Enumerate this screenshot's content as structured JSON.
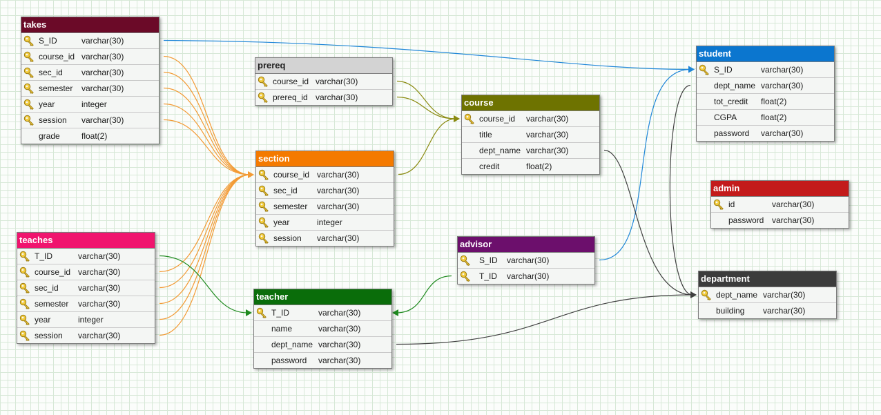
{
  "colors": {
    "takes": "#6b0a28",
    "prereq": "#d3d3d3",
    "course": "#6e7300",
    "section": "#f47a00",
    "student": "#0b76cf",
    "admin": "#c31b1b",
    "teaches": "#f0146e",
    "advisor": "#6c0f6c",
    "teacher": "#0a6d0a",
    "department": "#3c3c3c",
    "edge_orange": "#f39a34",
    "edge_olive": "#8a8a10",
    "edge_blue": "#1f86d8",
    "edge_green": "#1f8a1f",
    "edge_dark": "#404040"
  },
  "tables": {
    "takes": {
      "name": "takes",
      "columns": [
        {
          "name": "S_ID",
          "type": "varchar(30)",
          "key": true
        },
        {
          "name": "course_id",
          "type": "varchar(30)",
          "key": true
        },
        {
          "name": "sec_id",
          "type": "varchar(30)",
          "key": true
        },
        {
          "name": "semester",
          "type": "varchar(30)",
          "key": true
        },
        {
          "name": "year",
          "type": "integer",
          "key": true
        },
        {
          "name": "session",
          "type": "varchar(30)",
          "key": true
        },
        {
          "name": "grade",
          "type": "float(2)",
          "key": false
        }
      ]
    },
    "prereq": {
      "name": "prereq",
      "columns": [
        {
          "name": "course_id",
          "type": "varchar(30)",
          "key": true
        },
        {
          "name": "prereq_id",
          "type": "varchar(30)",
          "key": true
        }
      ]
    },
    "course": {
      "name": "course",
      "columns": [
        {
          "name": "course_id",
          "type": "varchar(30)",
          "key": true
        },
        {
          "name": "title",
          "type": "varchar(30)",
          "key": false
        },
        {
          "name": "dept_name",
          "type": "varchar(30)",
          "key": false
        },
        {
          "name": "credit",
          "type": "float(2)",
          "key": false
        }
      ]
    },
    "section": {
      "name": "section",
      "columns": [
        {
          "name": "course_id",
          "type": "varchar(30)",
          "key": true
        },
        {
          "name": "sec_id",
          "type": "varchar(30)",
          "key": true
        },
        {
          "name": "semester",
          "type": "varchar(30)",
          "key": true
        },
        {
          "name": "year",
          "type": "integer",
          "key": true
        },
        {
          "name": "session",
          "type": "varchar(30)",
          "key": true
        }
      ]
    },
    "student": {
      "name": "student",
      "columns": [
        {
          "name": "S_ID",
          "type": "varchar(30)",
          "key": true
        },
        {
          "name": "dept_name",
          "type": "varchar(30)",
          "key": false
        },
        {
          "name": "tot_credit",
          "type": "float(2)",
          "key": false
        },
        {
          "name": "CGPA",
          "type": "float(2)",
          "key": false
        },
        {
          "name": "password",
          "type": "varchar(30)",
          "key": false
        }
      ]
    },
    "admin": {
      "name": "admin",
      "columns": [
        {
          "name": "id",
          "type": "varchar(30)",
          "key": true
        },
        {
          "name": "password",
          "type": "varchar(30)",
          "key": false
        }
      ]
    },
    "teaches": {
      "name": "teaches",
      "columns": [
        {
          "name": "T_ID",
          "type": "varchar(30)",
          "key": true
        },
        {
          "name": "course_id",
          "type": "varchar(30)",
          "key": true
        },
        {
          "name": "sec_id",
          "type": "varchar(30)",
          "key": true
        },
        {
          "name": "semester",
          "type": "varchar(30)",
          "key": true
        },
        {
          "name": "year",
          "type": "integer",
          "key": true
        },
        {
          "name": "session",
          "type": "varchar(30)",
          "key": true
        }
      ]
    },
    "advisor": {
      "name": "advisor",
      "columns": [
        {
          "name": "S_ID",
          "type": "varchar(30)",
          "key": true
        },
        {
          "name": "T_ID",
          "type": "varchar(30)",
          "key": true
        }
      ]
    },
    "teacher": {
      "name": "teacher",
      "columns": [
        {
          "name": "T_ID",
          "type": "varchar(30)",
          "key": true
        },
        {
          "name": "name",
          "type": "varchar(30)",
          "key": false
        },
        {
          "name": "dept_name",
          "type": "varchar(30)",
          "key": false
        },
        {
          "name": "password",
          "type": "varchar(30)",
          "key": false
        }
      ]
    },
    "department": {
      "name": "department",
      "columns": [
        {
          "name": "dept_name",
          "type": "varchar(30)",
          "key": true
        },
        {
          "name": "building",
          "type": "varchar(30)",
          "key": false
        }
      ]
    }
  },
  "relations": [
    {
      "from": "takes.S_ID",
      "to": "student.S_ID",
      "color": "edge_blue"
    },
    {
      "from": "takes.course_id",
      "to": "section",
      "color": "edge_orange"
    },
    {
      "from": "takes.sec_id",
      "to": "section",
      "color": "edge_orange"
    },
    {
      "from": "takes.semester",
      "to": "section",
      "color": "edge_orange"
    },
    {
      "from": "takes.year",
      "to": "section",
      "color": "edge_orange"
    },
    {
      "from": "takes.session",
      "to": "section",
      "color": "edge_orange"
    },
    {
      "from": "teaches.course_id",
      "to": "section",
      "color": "edge_orange"
    },
    {
      "from": "teaches.sec_id",
      "to": "section",
      "color": "edge_orange"
    },
    {
      "from": "teaches.semester",
      "to": "section",
      "color": "edge_orange"
    },
    {
      "from": "teaches.year",
      "to": "section",
      "color": "edge_orange"
    },
    {
      "from": "teaches.session",
      "to": "section",
      "color": "edge_orange"
    },
    {
      "from": "teaches.T_ID",
      "to": "teacher.T_ID",
      "color": "edge_green"
    },
    {
      "from": "prereq.course_id",
      "to": "course.course_id",
      "color": "edge_olive"
    },
    {
      "from": "prereq.prereq_id",
      "to": "course.course_id",
      "color": "edge_olive"
    },
    {
      "from": "section.course_id",
      "to": "course.course_id",
      "color": "edge_olive"
    },
    {
      "from": "advisor.S_ID",
      "to": "student.S_ID",
      "color": "edge_blue"
    },
    {
      "from": "advisor.T_ID",
      "to": "teacher.T_ID",
      "color": "edge_green"
    },
    {
      "from": "course.dept_name",
      "to": "department.dept_name",
      "color": "edge_dark"
    },
    {
      "from": "student.dept_name",
      "to": "department.dept_name",
      "color": "edge_dark"
    },
    {
      "from": "teacher.dept_name",
      "to": "department.dept_name",
      "color": "edge_dark"
    }
  ]
}
